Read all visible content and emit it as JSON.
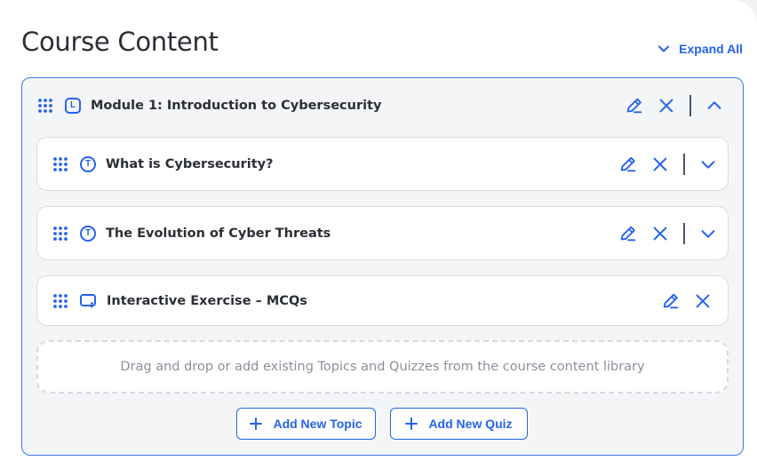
{
  "page": {
    "title": "Course Content",
    "expand_all_label": "Expand All"
  },
  "module": {
    "type_letter": "L",
    "title": "Module 1: Introduction to Cybersecurity",
    "items": [
      {
        "type_letter": "T",
        "title": "What is Cybersecurity?"
      },
      {
        "type_letter": "T",
        "title": "The Evolution of Cyber Threats"
      },
      {
        "type": "quiz",
        "title": "Interactive Exercise – MCQs"
      }
    ],
    "dropzone_text": "Drag and drop or add existing Topics and Quizzes from the course content library",
    "add_topic_label": "Add New Topic",
    "add_quiz_label": "Add New Quiz"
  },
  "colors": {
    "accent": "#2563eb",
    "border": "#3b78e7"
  }
}
